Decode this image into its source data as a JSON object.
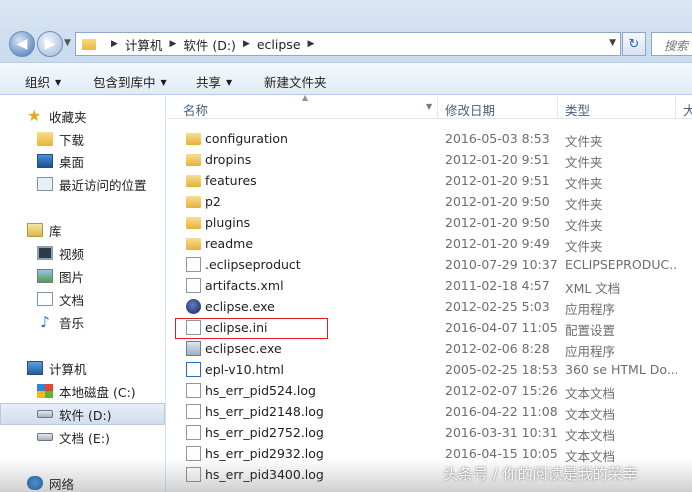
{
  "address": {
    "crumbs": [
      "计算机",
      "软件 (D:)",
      "eclipse"
    ],
    "search_placeholder": "搜索"
  },
  "toolbar": {
    "organize": "组织",
    "include_in_library": "包含到库中",
    "share": "共享",
    "new_folder": "新建文件夹"
  },
  "sidebar": {
    "favorites": "收藏夹",
    "downloads": "下载",
    "desktop": "桌面",
    "recent": "最近访问的位置",
    "libraries": "库",
    "videos": "视频",
    "pictures": "图片",
    "documents": "文档",
    "music": "音乐",
    "computer": "计算机",
    "drive_c": "本地磁盘 (C:)",
    "drive_d": "软件 (D:)",
    "drive_e": "文档 (E:)",
    "network": "网络"
  },
  "columns": {
    "name": "名称",
    "date": "修改日期",
    "type": "类型",
    "size": "大"
  },
  "files": [
    {
      "name": "configuration",
      "date": "2016-05-03 8:53",
      "type": "文件夹",
      "icon": "folder-icon"
    },
    {
      "name": "dropins",
      "date": "2012-01-20 9:51",
      "type": "文件夹",
      "icon": "folder-icon"
    },
    {
      "name": "features",
      "date": "2012-01-20 9:51",
      "type": "文件夹",
      "icon": "folder-icon"
    },
    {
      "name": "p2",
      "date": "2012-01-20 9:50",
      "type": "文件夹",
      "icon": "folder-icon"
    },
    {
      "name": "plugins",
      "date": "2012-01-20 9:50",
      "type": "文件夹",
      "icon": "folder-icon"
    },
    {
      "name": "readme",
      "date": "2012-01-20 9:49",
      "type": "文件夹",
      "icon": "folder-icon"
    },
    {
      "name": ".eclipseproduct",
      "date": "2010-07-29 10:37",
      "type": "ECLIPSEPRODUC...",
      "icon": "file-icon"
    },
    {
      "name": "artifacts.xml",
      "date": "2011-02-18 4:57",
      "type": "XML 文档",
      "icon": "xml-file-icon"
    },
    {
      "name": "eclipse.exe",
      "date": "2012-02-25 5:03",
      "type": "应用程序",
      "icon": "eclipse-exe-icon"
    },
    {
      "name": "eclipse.ini",
      "date": "2016-04-07 11:05",
      "type": "配置设置",
      "icon": "ini-file-icon"
    },
    {
      "name": "eclipsec.exe",
      "date": "2012-02-06 8:28",
      "type": "应用程序",
      "icon": "exe-icon"
    },
    {
      "name": "epl-v10.html",
      "date": "2005-02-25 18:53",
      "type": "360 se HTML Do...",
      "icon": "html-file-icon"
    },
    {
      "name": "hs_err_pid524.log",
      "date": "2012-02-07 15:26",
      "type": "文本文档",
      "icon": "text-file-icon"
    },
    {
      "name": "hs_err_pid2148.log",
      "date": "2016-04-22 11:08",
      "type": "文本文档",
      "icon": "text-file-icon"
    },
    {
      "name": "hs_err_pid2752.log",
      "date": "2016-03-31 10:31",
      "type": "文本文档",
      "icon": "text-file-icon"
    },
    {
      "name": "hs_err_pid2932.log",
      "date": "2016-04-15 10:05",
      "type": "文本文档",
      "icon": "text-file-icon"
    },
    {
      "name": "hs_err_pid3400.log",
      "date": "",
      "type": "",
      "icon": "text-file-icon"
    }
  ],
  "watermark": "头条号 / 你的阅读是我的荣幸"
}
